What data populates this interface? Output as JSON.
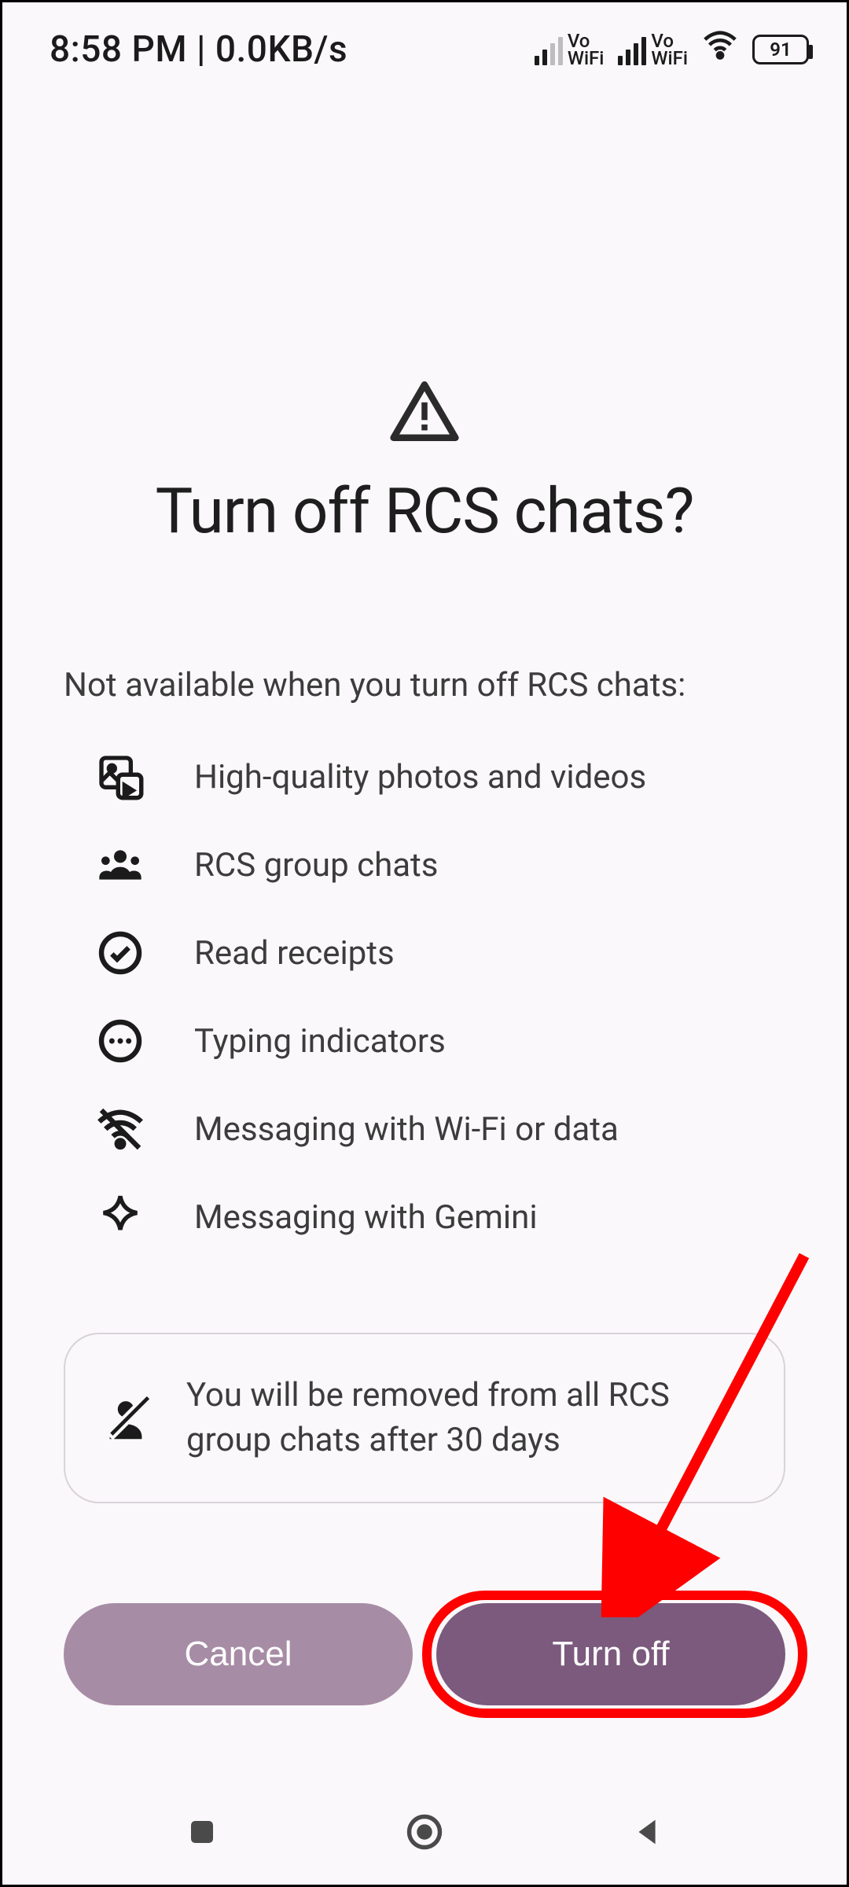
{
  "statusbar": {
    "time_net": "8:58 PM | 0.0KB/s",
    "vowifi1_top": "Vo",
    "vowifi1_bot": "WiFi",
    "vowifi2_top": "Vo",
    "vowifi2_bot": "WiFi",
    "battery": "91"
  },
  "dialog": {
    "title": "Turn off RCS chats?",
    "intro": "Not available when you turn off RCS chats:",
    "features": {
      "f0": "High-quality photos and videos",
      "f1": "RCS group chats",
      "f2": "Read receipts",
      "f3": "Typing indicators",
      "f4": "Messaging with Wi-Fi or data",
      "f5": "Messaging with Gemini"
    },
    "note": "You will be removed from all RCS group chats after 30 days"
  },
  "buttons": {
    "cancel": "Cancel",
    "confirm": "Turn off"
  }
}
